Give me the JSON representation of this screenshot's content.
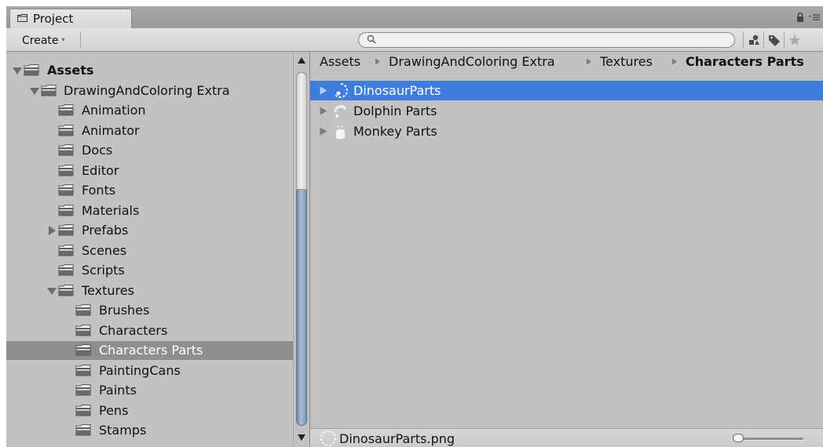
{
  "window": {
    "tab_label": "Project",
    "icons": {
      "tab": "folder-icon",
      "lock": "lock-icon",
      "menu": "tab-menu-icon"
    }
  },
  "toolbar": {
    "create_label": "Create",
    "create_arrow": "▾",
    "search_value": "",
    "icons": [
      "filter-by-type-icon",
      "filter-by-label-icon",
      "favorite-star-icon"
    ]
  },
  "tree": {
    "items": [
      {
        "label": "Assets",
        "expanded": true,
        "bold": true
      },
      {
        "label": "DrawingAndColoring Extra",
        "expanded": true
      },
      {
        "label": "Animation"
      },
      {
        "label": "Animator"
      },
      {
        "label": "Docs"
      },
      {
        "label": "Editor"
      },
      {
        "label": "Fonts"
      },
      {
        "label": "Materials"
      },
      {
        "label": "Prefabs",
        "expanded": false
      },
      {
        "label": "Scenes"
      },
      {
        "label": "Scripts"
      },
      {
        "label": "Textures",
        "expanded": true
      },
      {
        "label": "Brushes"
      },
      {
        "label": "Characters"
      },
      {
        "label": "Characters Parts",
        "selected": true
      },
      {
        "label": "PaintingCans"
      },
      {
        "label": "Paints"
      },
      {
        "label": "Pens"
      },
      {
        "label": "Stamps"
      }
    ]
  },
  "breadcrumb": {
    "items": [
      "Assets",
      "DrawingAndColoring Extra",
      "Textures",
      "Characters Parts"
    ]
  },
  "files": {
    "items": [
      {
        "label": "DinosaurParts",
        "selected": true
      },
      {
        "label": "Dolphin Parts",
        "selected": false
      },
      {
        "label": "Monkey Parts",
        "selected": false
      }
    ]
  },
  "status": {
    "filename": "DinosaurParts.png",
    "zoom_level": 0
  },
  "colors": {
    "selection_blue": "#3e7ce0",
    "tree_selection_gray": "#8e8e8e",
    "panel_gray": "#c2c2c2"
  }
}
